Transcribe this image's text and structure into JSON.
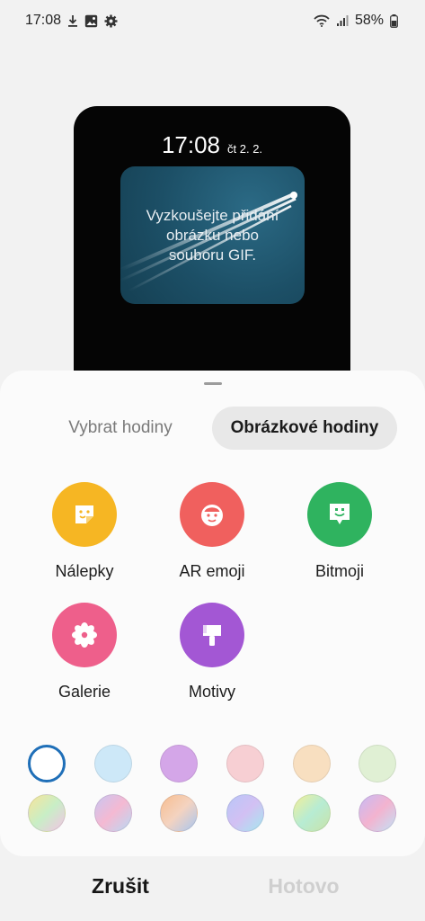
{
  "status_bar": {
    "time": "17:08",
    "battery": "58%",
    "icons": [
      "download-icon",
      "gallery-icon",
      "settings-icon",
      "wifi-icon",
      "signal-icon",
      "battery-icon"
    ]
  },
  "preview": {
    "time": "17:08",
    "date": "čt 2. 2.",
    "prompt": "Vyzkoušejte přidání\nobrázku nebo\nsouboru GIF."
  },
  "tabs": {
    "inactive": "Vybrat hodiny",
    "active": "Obrázkové hodiny"
  },
  "apps": [
    {
      "label": "Nálepky",
      "color": "#f6b623",
      "icon": "sticker-icon"
    },
    {
      "label": "AR emoji",
      "color": "#f0605e",
      "icon": "ar-emoji-icon"
    },
    {
      "label": "Bitmoji",
      "color": "#2fb35f",
      "icon": "bitmoji-icon"
    },
    {
      "label": "Galerie",
      "color": "#ee5f8b",
      "icon": "flower-icon"
    },
    {
      "label": "Motivy",
      "color": "#a357d4",
      "icon": "brush-icon"
    }
  ],
  "swatch_colors": {
    "solid": [
      "#ffffff",
      "#cde8f8",
      "#d4a6e8",
      "#f7cfd3",
      "#f8dfc0",
      "#e0f0d4"
    ],
    "gradient": [
      "gradient-1",
      "gradient-2",
      "gradient-3",
      "gradient-4",
      "gradient-5",
      "gradient-6"
    ],
    "selected_ring": "#1f6fb8"
  },
  "actions": {
    "cancel": "Zrušit",
    "done": "Hotovo"
  }
}
